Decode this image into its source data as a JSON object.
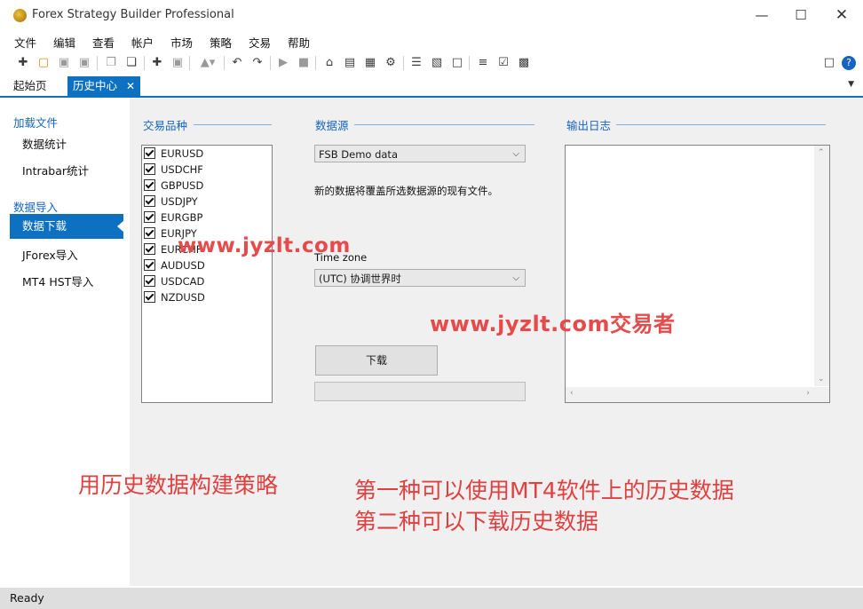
{
  "window": {
    "title": "Forex Strategy Builder Professional"
  },
  "menu": [
    "文件",
    "编辑",
    "查看",
    "帐户",
    "市场",
    "策略",
    "交易",
    "帮助"
  ],
  "tabs": {
    "home": "起始页",
    "history": "历史中心"
  },
  "sidebar": {
    "group1": "加载文件",
    "items1": [
      "数据统计",
      "Intrabar统计"
    ],
    "group2": "数据导入",
    "items2": [
      "数据下载",
      "JForex导入",
      "MT4 HST导入"
    ]
  },
  "symbols": {
    "header": "交易品种",
    "items": [
      "EURUSD",
      "USDCHF",
      "GBPUSD",
      "USDJPY",
      "EURGBP",
      "EURJPY",
      "EURCHF",
      "AUDUSD",
      "USDCAD",
      "NZDUSD"
    ]
  },
  "datasource": {
    "header": "数据源",
    "selected": "FSB Demo data",
    "note": "新的数据将覆盖所选数据源的现有文件。",
    "timezone_label": "Time zone",
    "timezone_selected": "(UTC) 协调世界时",
    "download_label": "下载"
  },
  "log": {
    "header": "输出日志"
  },
  "status": {
    "text": "Ready"
  },
  "overlay": {
    "watermark1": "www.jyzlt.com",
    "watermark2": "www.jyzlt.com交易者",
    "note1": "用历史数据构建策略",
    "note2": "第一种可以使用MT4软件上的历史数据",
    "note3": "第二种可以下载历史数据"
  },
  "colors": {
    "accent": "#0e70c0",
    "annotation": "#e04040"
  }
}
